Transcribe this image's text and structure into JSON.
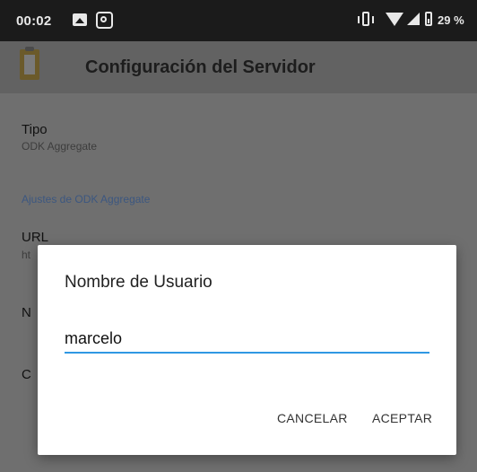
{
  "status_bar": {
    "time": "00:02",
    "battery": "29 %",
    "icons": [
      "gallery-icon",
      "app-notification-icon",
      "vibrate-icon",
      "wifi-icon",
      "signal-icon",
      "battery-icon"
    ]
  },
  "app_bar": {
    "title": "Configuración del Servidor",
    "icon": "clipboard-icon"
  },
  "settings": {
    "type_title": "Tipo",
    "type_summary": "ODK Aggregate",
    "category": "Ajustes de ODK Aggregate",
    "url_title": "URL",
    "url_summary_partial": "ht",
    "username_partial": "N",
    "password_partial": "C"
  },
  "dialog": {
    "title": "Nombre de Usuario",
    "input_value": "marcelo",
    "cancel_label": "CANCELAR",
    "accept_label": "ACEPTAR"
  },
  "colors": {
    "accent": "#2f98e3",
    "category": "#3c5780",
    "scrim": "#6f6f6f"
  }
}
